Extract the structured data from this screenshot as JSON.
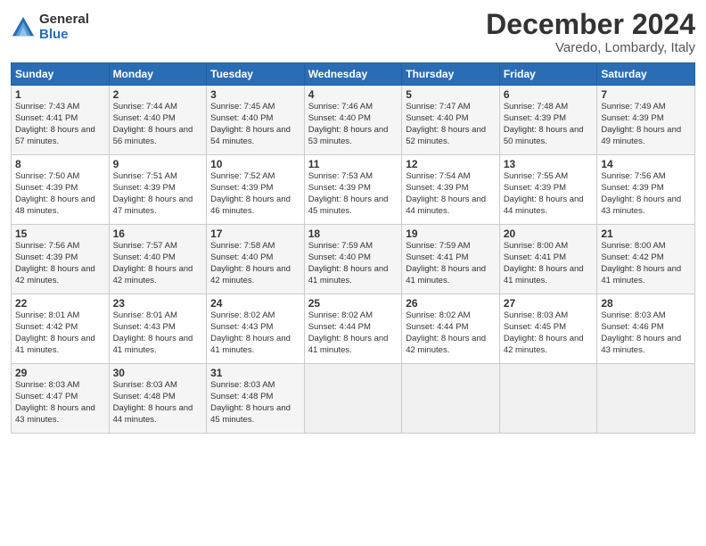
{
  "header": {
    "logo_general": "General",
    "logo_blue": "Blue",
    "month_title": "December 2024",
    "location": "Varedo, Lombardy, Italy"
  },
  "days_of_week": [
    "Sunday",
    "Monday",
    "Tuesday",
    "Wednesday",
    "Thursday",
    "Friday",
    "Saturday"
  ],
  "weeks": [
    [
      {
        "day": "1",
        "sunrise": "Sunrise: 7:43 AM",
        "sunset": "Sunset: 4:41 PM",
        "daylight": "Daylight: 8 hours and 57 minutes."
      },
      {
        "day": "2",
        "sunrise": "Sunrise: 7:44 AM",
        "sunset": "Sunset: 4:40 PM",
        "daylight": "Daylight: 8 hours and 56 minutes."
      },
      {
        "day": "3",
        "sunrise": "Sunrise: 7:45 AM",
        "sunset": "Sunset: 4:40 PM",
        "daylight": "Daylight: 8 hours and 54 minutes."
      },
      {
        "day": "4",
        "sunrise": "Sunrise: 7:46 AM",
        "sunset": "Sunset: 4:40 PM",
        "daylight": "Daylight: 8 hours and 53 minutes."
      },
      {
        "day": "5",
        "sunrise": "Sunrise: 7:47 AM",
        "sunset": "Sunset: 4:40 PM",
        "daylight": "Daylight: 8 hours and 52 minutes."
      },
      {
        "day": "6",
        "sunrise": "Sunrise: 7:48 AM",
        "sunset": "Sunset: 4:39 PM",
        "daylight": "Daylight: 8 hours and 50 minutes."
      },
      {
        "day": "7",
        "sunrise": "Sunrise: 7:49 AM",
        "sunset": "Sunset: 4:39 PM",
        "daylight": "Daylight: 8 hours and 49 minutes."
      }
    ],
    [
      {
        "day": "8",
        "sunrise": "Sunrise: 7:50 AM",
        "sunset": "Sunset: 4:39 PM",
        "daylight": "Daylight: 8 hours and 48 minutes."
      },
      {
        "day": "9",
        "sunrise": "Sunrise: 7:51 AM",
        "sunset": "Sunset: 4:39 PM",
        "daylight": "Daylight: 8 hours and 47 minutes."
      },
      {
        "day": "10",
        "sunrise": "Sunrise: 7:52 AM",
        "sunset": "Sunset: 4:39 PM",
        "daylight": "Daylight: 8 hours and 46 minutes."
      },
      {
        "day": "11",
        "sunrise": "Sunrise: 7:53 AM",
        "sunset": "Sunset: 4:39 PM",
        "daylight": "Daylight: 8 hours and 45 minutes."
      },
      {
        "day": "12",
        "sunrise": "Sunrise: 7:54 AM",
        "sunset": "Sunset: 4:39 PM",
        "daylight": "Daylight: 8 hours and 44 minutes."
      },
      {
        "day": "13",
        "sunrise": "Sunrise: 7:55 AM",
        "sunset": "Sunset: 4:39 PM",
        "daylight": "Daylight: 8 hours and 44 minutes."
      },
      {
        "day": "14",
        "sunrise": "Sunrise: 7:56 AM",
        "sunset": "Sunset: 4:39 PM",
        "daylight": "Daylight: 8 hours and 43 minutes."
      }
    ],
    [
      {
        "day": "15",
        "sunrise": "Sunrise: 7:56 AM",
        "sunset": "Sunset: 4:39 PM",
        "daylight": "Daylight: 8 hours and 42 minutes."
      },
      {
        "day": "16",
        "sunrise": "Sunrise: 7:57 AM",
        "sunset": "Sunset: 4:40 PM",
        "daylight": "Daylight: 8 hours and 42 minutes."
      },
      {
        "day": "17",
        "sunrise": "Sunrise: 7:58 AM",
        "sunset": "Sunset: 4:40 PM",
        "daylight": "Daylight: 8 hours and 42 minutes."
      },
      {
        "day": "18",
        "sunrise": "Sunrise: 7:59 AM",
        "sunset": "Sunset: 4:40 PM",
        "daylight": "Daylight: 8 hours and 41 minutes."
      },
      {
        "day": "19",
        "sunrise": "Sunrise: 7:59 AM",
        "sunset": "Sunset: 4:41 PM",
        "daylight": "Daylight: 8 hours and 41 minutes."
      },
      {
        "day": "20",
        "sunrise": "Sunrise: 8:00 AM",
        "sunset": "Sunset: 4:41 PM",
        "daylight": "Daylight: 8 hours and 41 minutes."
      },
      {
        "day": "21",
        "sunrise": "Sunrise: 8:00 AM",
        "sunset": "Sunset: 4:42 PM",
        "daylight": "Daylight: 8 hours and 41 minutes."
      }
    ],
    [
      {
        "day": "22",
        "sunrise": "Sunrise: 8:01 AM",
        "sunset": "Sunset: 4:42 PM",
        "daylight": "Daylight: 8 hours and 41 minutes."
      },
      {
        "day": "23",
        "sunrise": "Sunrise: 8:01 AM",
        "sunset": "Sunset: 4:43 PM",
        "daylight": "Daylight: 8 hours and 41 minutes."
      },
      {
        "day": "24",
        "sunrise": "Sunrise: 8:02 AM",
        "sunset": "Sunset: 4:43 PM",
        "daylight": "Daylight: 8 hours and 41 minutes."
      },
      {
        "day": "25",
        "sunrise": "Sunrise: 8:02 AM",
        "sunset": "Sunset: 4:44 PM",
        "daylight": "Daylight: 8 hours and 41 minutes."
      },
      {
        "day": "26",
        "sunrise": "Sunrise: 8:02 AM",
        "sunset": "Sunset: 4:44 PM",
        "daylight": "Daylight: 8 hours and 42 minutes."
      },
      {
        "day": "27",
        "sunrise": "Sunrise: 8:03 AM",
        "sunset": "Sunset: 4:45 PM",
        "daylight": "Daylight: 8 hours and 42 minutes."
      },
      {
        "day": "28",
        "sunrise": "Sunrise: 8:03 AM",
        "sunset": "Sunset: 4:46 PM",
        "daylight": "Daylight: 8 hours and 43 minutes."
      }
    ],
    [
      {
        "day": "29",
        "sunrise": "Sunrise: 8:03 AM",
        "sunset": "Sunset: 4:47 PM",
        "daylight": "Daylight: 8 hours and 43 minutes."
      },
      {
        "day": "30",
        "sunrise": "Sunrise: 8:03 AM",
        "sunset": "Sunset: 4:48 PM",
        "daylight": "Daylight: 8 hours and 44 minutes."
      },
      {
        "day": "31",
        "sunrise": "Sunrise: 8:03 AM",
        "sunset": "Sunset: 4:48 PM",
        "daylight": "Daylight: 8 hours and 45 minutes."
      },
      null,
      null,
      null,
      null
    ]
  ]
}
